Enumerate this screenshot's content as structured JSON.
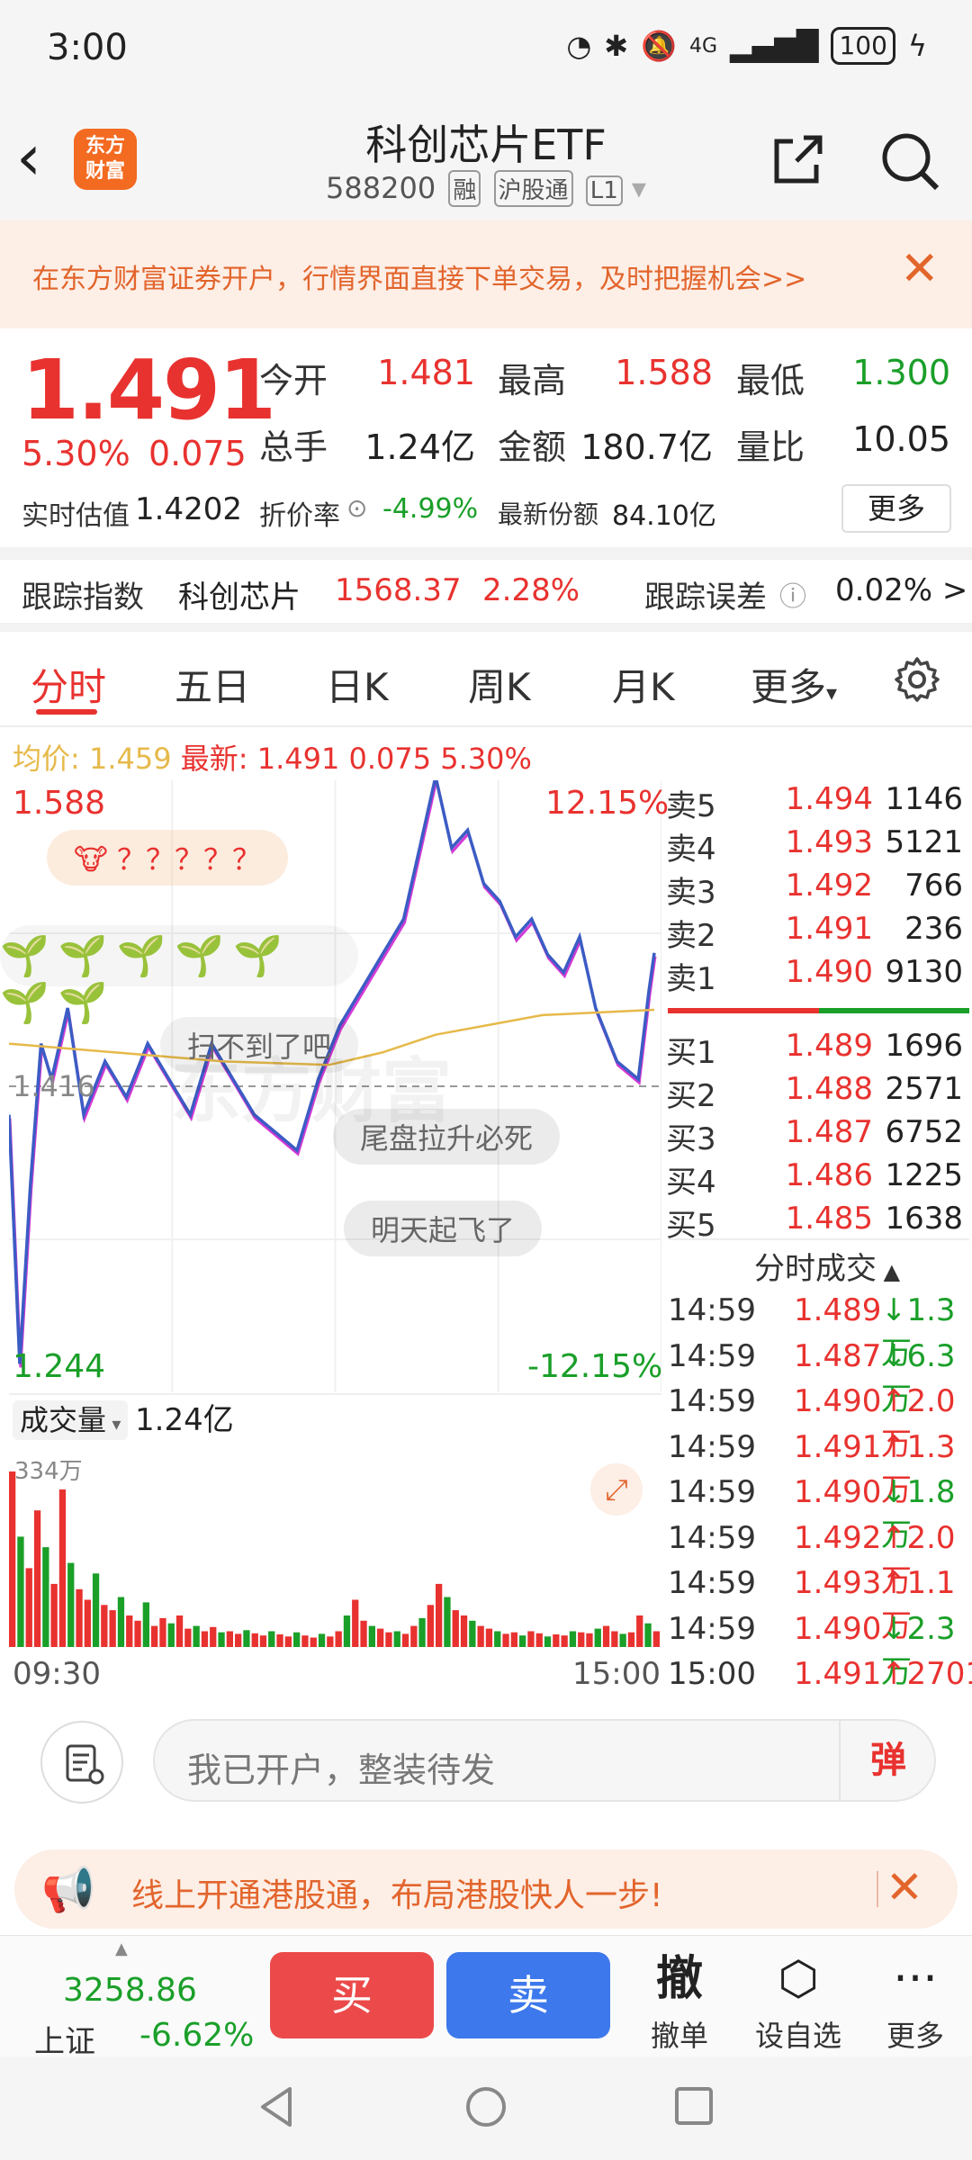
{
  "status": {
    "time": "3:00",
    "network": "4G",
    "battery": "100"
  },
  "nav": {
    "logo_text": "东方财富",
    "title": "科创芯片ETF",
    "code": "588200",
    "tags": [
      "融",
      "沪股通",
      "L1"
    ]
  },
  "banner": {
    "text": "在东方财富证券开户，行情界面直接下单交易，及时把握机会>>"
  },
  "quote": {
    "price": "1.491",
    "pct": "5.30%",
    "change": "0.075",
    "open_label": "今开",
    "open": "1.481",
    "high_label": "最高",
    "high": "1.588",
    "low_label": "最低",
    "low": "1.300",
    "volume_label": "总手",
    "volume": "1.24亿",
    "amount_label": "金额",
    "amount": "180.7亿",
    "ratio_label": "量比",
    "ratio": "10.05",
    "iopv_label": "实时估值",
    "iopv": "1.4202",
    "discount_label": "折价率",
    "discount": "-4.99%",
    "shares_label": "最新份额",
    "shares": "84.10亿",
    "more": "更多"
  },
  "tracking": {
    "label": "跟踪指数",
    "index_name": "科创芯片",
    "index_value": "1568.37",
    "index_pct": "2.28%",
    "error_label": "跟踪误差",
    "error": "0.02% >"
  },
  "tabs": [
    "分时",
    "五日",
    "日K",
    "周K",
    "月K",
    "更多"
  ],
  "chart_header": {
    "avg_label": "均价:",
    "avg": "1.459",
    "last_label": "最新:",
    "last": "1.491",
    "last_change": "0.075",
    "last_pct": "5.30%"
  },
  "chart": {
    "top_price": "1.588",
    "top_pct": "12.15%",
    "bottom_price": "1.244",
    "bottom_pct": "-12.15%",
    "ref_price": "1.416",
    "watermark": "东方财富",
    "vol_label": "成交量",
    "vol_total": "1.24亿",
    "vol_max": "334万",
    "time_start": "09:30",
    "time_end": "15:00",
    "danmaku": [
      "？？？？？",
      "扫不到了吧",
      "尾盘拉升必死",
      "明天起飞了"
    ]
  },
  "orderbook": {
    "asks": [
      {
        "label": "卖5",
        "price": "1.494",
        "vol": "1146"
      },
      {
        "label": "卖4",
        "price": "1.493",
        "vol": "5121"
      },
      {
        "label": "卖3",
        "price": "1.492",
        "vol": "766"
      },
      {
        "label": "卖2",
        "price": "1.491",
        "vol": "236"
      },
      {
        "label": "卖1",
        "price": "1.490",
        "vol": "9130"
      }
    ],
    "bids": [
      {
        "label": "买1",
        "price": "1.489",
        "vol": "1696"
      },
      {
        "label": "买2",
        "price": "1.488",
        "vol": "2571"
      },
      {
        "label": "买3",
        "price": "1.487",
        "vol": "6752"
      },
      {
        "label": "买4",
        "price": "1.486",
        "vol": "1225"
      },
      {
        "label": "买5",
        "price": "1.485",
        "vol": "1638"
      }
    ],
    "ticks_title": "分时成交",
    "ticks": [
      {
        "time": "14:59",
        "price": "1.489",
        "vol": "↓1.3万",
        "dir": "down"
      },
      {
        "time": "14:59",
        "price": "1.487",
        "vol": "↓6.3万",
        "dir": "down"
      },
      {
        "time": "14:59",
        "price": "1.490",
        "vol": "↑2.0万",
        "dir": "up"
      },
      {
        "time": "14:59",
        "price": "1.491",
        "vol": "↑1.3万",
        "dir": "up"
      },
      {
        "time": "14:59",
        "price": "1.490",
        "vol": "↓1.8万",
        "dir": "down"
      },
      {
        "time": "14:59",
        "price": "1.492",
        "vol": "↑2.0万",
        "dir": "up"
      },
      {
        "time": "14:59",
        "price": "1.493",
        "vol": "↑1.1万",
        "dir": "up"
      },
      {
        "time": "14:59",
        "price": "1.490",
        "vol": "↓2.3万",
        "dir": "down"
      },
      {
        "time": "15:00",
        "price": "1.491",
        "vol": "↑2701",
        "dir": "up"
      }
    ]
  },
  "comment": {
    "placeholder": "我已开户，整装待发",
    "danmu": "弹"
  },
  "promo": {
    "text": "线上开通港股通，布局港股快人一步!"
  },
  "trade_bar": {
    "index_value": "3258.86",
    "index_name": "上证",
    "index_pct": "-6.62%",
    "buy": "买",
    "sell": "卖",
    "cancel_icon": "撤",
    "cancel": "撤单",
    "watch": "设自选",
    "more": "更多"
  },
  "chart_data": {
    "type": "line",
    "title": "",
    "xlabel": "",
    "ylabel": "",
    "x_range": [
      "09:30",
      "15:00"
    ],
    "ylim": [
      1.244,
      1.588
    ],
    "reference": 1.416,
    "series": [
      {
        "name": "",
        "color": "#3b5cc4",
        "points": [
          [
            0,
            1.4
          ],
          [
            2,
            1.26
          ],
          [
            4,
            1.36
          ],
          [
            6,
            1.44
          ],
          [
            8,
            1.42
          ],
          [
            11,
            1.46
          ],
          [
            14,
            1.4
          ],
          [
            18,
            1.43
          ],
          [
            22,
            1.41
          ],
          [
            26,
            1.44
          ],
          [
            30,
            1.42
          ],
          [
            34,
            1.4
          ],
          [
            38,
            1.44
          ],
          [
            42,
            1.42
          ],
          [
            46,
            1.4
          ],
          [
            50,
            1.39
          ],
          [
            54,
            1.38
          ],
          [
            58,
            1.42
          ],
          [
            62,
            1.45
          ],
          [
            66,
            1.47
          ],
          [
            70,
            1.49
          ],
          [
            74,
            1.51
          ],
          [
            77,
            1.55
          ],
          [
            80,
            1.59
          ],
          [
            83,
            1.55
          ],
          [
            86,
            1.56
          ],
          [
            89,
            1.53
          ],
          [
            92,
            1.52
          ],
          [
            95,
            1.5
          ],
          [
            98,
            1.51
          ],
          [
            101,
            1.49
          ],
          [
            104,
            1.48
          ],
          [
            107,
            1.5
          ],
          [
            110,
            1.46
          ],
          [
            114,
            1.43
          ],
          [
            118,
            1.42
          ],
          [
            120,
            1.47
          ],
          [
            121,
            1.491
          ]
        ]
      },
      {
        "name": "均价",
        "color": "#e6b94a",
        "points": [
          [
            0,
            1.44
          ],
          [
            20,
            1.435
          ],
          [
            40,
            1.43
          ],
          [
            60,
            1.428
          ],
          [
            70,
            1.435
          ],
          [
            80,
            1.445
          ],
          [
            100,
            1.456
          ],
          [
            121,
            1.459
          ]
        ]
      }
    ],
    "volume": [
      334,
      210,
      150,
      260,
      190,
      120,
      300,
      160,
      110,
      90,
      140,
      80,
      70,
      95,
      60,
      50,
      85,
      40,
      55,
      45,
      60,
      35,
      40,
      30,
      38,
      28,
      30,
      25,
      32,
      26,
      22,
      30,
      24,
      20,
      28,
      22,
      18,
      25,
      20,
      30,
      60,
      90,
      50,
      40,
      35,
      28,
      30,
      25,
      40,
      55,
      80,
      120,
      95,
      70,
      60,
      50,
      40,
      35,
      30,
      25,
      28,
      22,
      30,
      26,
      20,
      24,
      22,
      30,
      28,
      26,
      35,
      40,
      30,
      25,
      28,
      60,
      45,
      30
    ]
  }
}
